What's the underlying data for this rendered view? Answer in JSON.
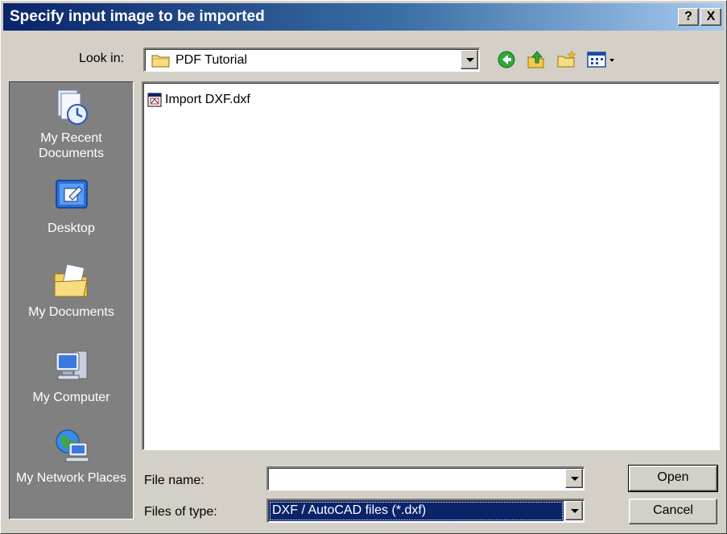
{
  "window": {
    "title": "Specify input image to be imported",
    "help_label": "?",
    "close_label": "X"
  },
  "lookin": {
    "label": "Look in:",
    "value": "PDF Tutorial"
  },
  "places": [
    {
      "label": "My Recent Documents",
      "icon": "recent-documents-icon"
    },
    {
      "label": "Desktop",
      "icon": "desktop-icon"
    },
    {
      "label": "My Documents",
      "icon": "my-documents-icon"
    },
    {
      "label": "My Computer",
      "icon": "my-computer-icon"
    },
    {
      "label": "My Network Places",
      "icon": "network-places-icon"
    }
  ],
  "files": [
    {
      "name": "Import DXF.dxf",
      "icon": "dxf-file-icon"
    }
  ],
  "filename": {
    "label": "File name:",
    "value": ""
  },
  "filetype": {
    "label": "Files of type:",
    "value": "DXF / AutoCAD files (*.dxf)"
  },
  "buttons": {
    "open": "Open",
    "cancel": "Cancel"
  },
  "colors": {
    "titlebar": "#0a246a",
    "face": "#d4d0c8",
    "places_bg": "#808080",
    "selection": "#0a246a"
  }
}
